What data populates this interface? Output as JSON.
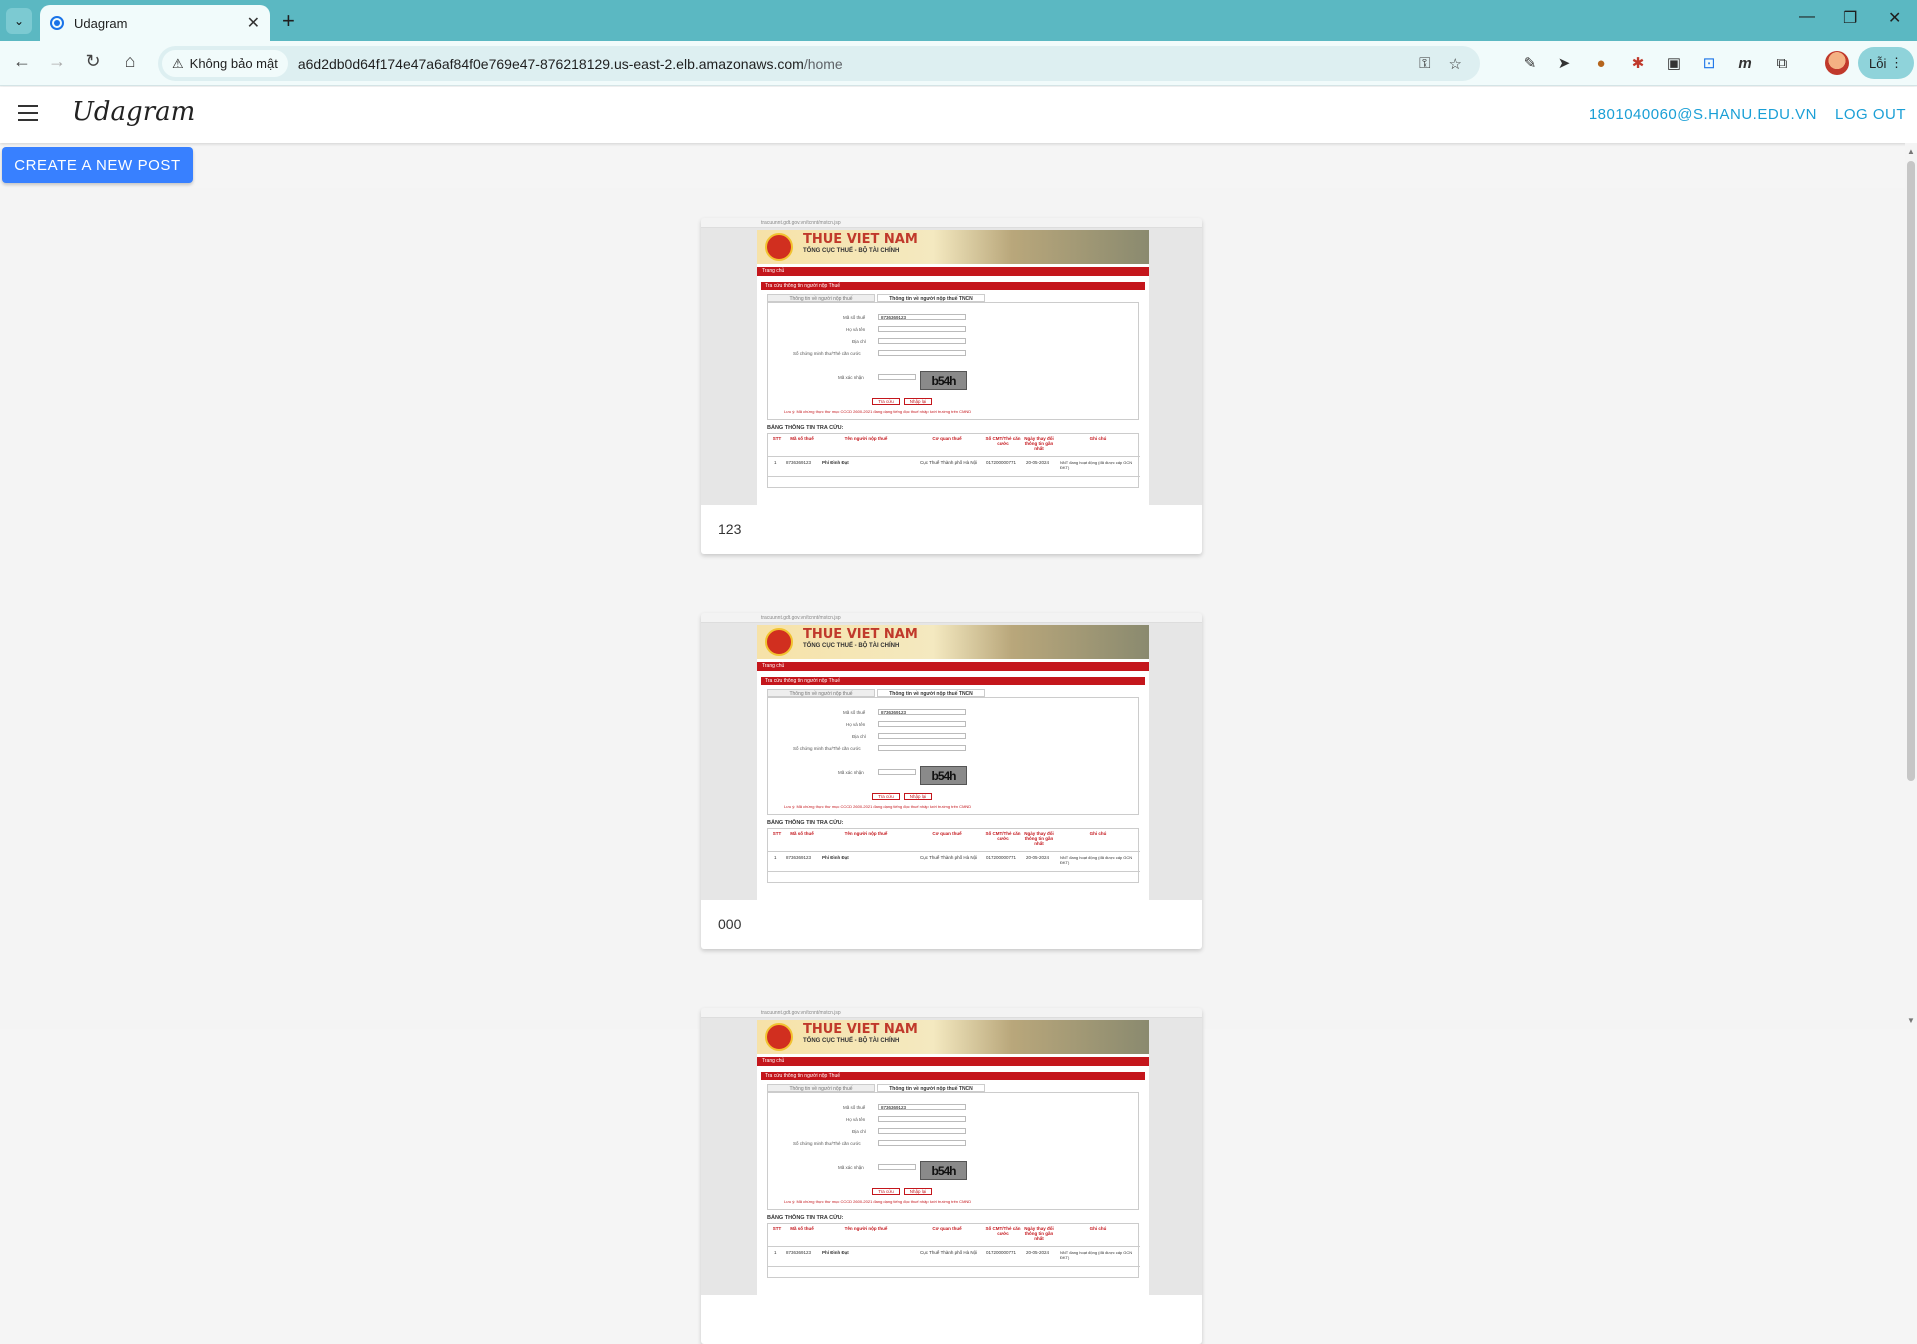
{
  "browser": {
    "tab_title": "Udagram",
    "security_label": "Không bảo mật",
    "url_host": "a6d2db0d64f174e47a6af84f0e769e47-876218129.us-east-2.elb.amazonaws.com",
    "url_path": "/home",
    "error_label": "Lỗi"
  },
  "app": {
    "brand": "Udagram",
    "user_email": "1801040060@S.HANU.EDU.VN",
    "logout_label": "LOG OUT",
    "create_label": "CREATE A NEW POST"
  },
  "feed": {
    "posts": [
      {
        "caption": "123"
      },
      {
        "caption": "000"
      },
      {
        "caption": ""
      }
    ]
  },
  "thumbnail": {
    "mini_url": "tracuunnt.gdt.gov.vn/tcnnt/mstcn.jsp",
    "brand": "THUE VIET NAM",
    "subtitle": "TỔNG CỤC THUẾ - BỘ TÀI CHÍNH",
    "nav": "Trang chủ",
    "section": "Tra cứu thông tin người nộp Thuế",
    "tab1": "Thông tin về người nộp thuế",
    "tab2": "Thông tin về người nộp thuế TNCN",
    "field_mst": "Mã số thuế",
    "field_mst_value": "8736369123",
    "field_name": "Họ và tên",
    "field_address": "Địa chỉ",
    "field_id": "Số chứng minh thư/Thẻ căn cước",
    "field_captcha": "Mã xác nhận",
    "captcha": "b54h",
    "btn_search": "Tra cứu",
    "btn_reset": "Nhập lại",
    "note": "Lưu ý: Mã chứng thực thư mục CCCD 2600-2021 đang dạng tiếng đọc thuế nhập lười trường trên CMND",
    "table_title": "BẢNG THÔNG TIN TRA CỨU:",
    "columns": [
      "STT",
      "Mã số thuế",
      "Tên người nộp thuế",
      "Cơ quan thuế",
      "Số CMT/Thẻ căn cước",
      "Ngày thay đổi thông tin gần nhất",
      "Ghi chú"
    ],
    "row": [
      "1",
      "8736369123",
      "Phí Đình Đạt",
      "Cục Thuế Thành phố Hà Nội",
      "017200000771",
      "20-05-2024",
      "NNT đang hoạt động (đã được cấp GCN ĐKT)"
    ]
  }
}
